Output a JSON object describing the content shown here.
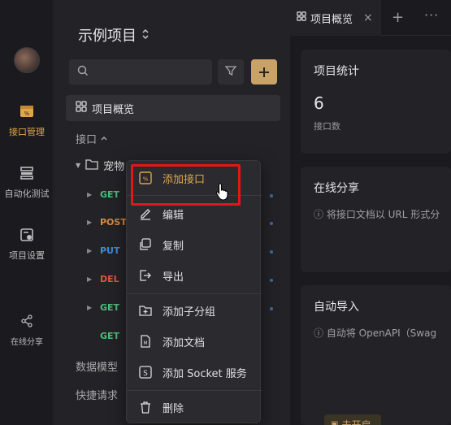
{
  "rail": {
    "items": [
      {
        "label": "接口管理",
        "icon": "api-management-icon"
      },
      {
        "label": "自动化测试",
        "icon": "automation-icon"
      },
      {
        "label": "项目设置",
        "icon": "settings-icon"
      },
      {
        "label": "在线分享",
        "icon": "share-icon"
      }
    ]
  },
  "sidebar": {
    "project_title": "示例项目",
    "search_placeholder": "",
    "overview_label": "项目概览",
    "section_api": "接口",
    "folder_name": "宠物",
    "apis": [
      {
        "method": "GET"
      },
      {
        "method": "POST"
      },
      {
        "method": "PUT"
      },
      {
        "method": "DEL"
      },
      {
        "method": "GET"
      },
      {
        "method": "GET"
      }
    ],
    "section_models": "数据模型",
    "section_quick": "快捷请求"
  },
  "tabs": {
    "active_label": "项目概览",
    "close": "×",
    "plus": "+",
    "more": "···"
  },
  "main": {
    "stats_title": "项目统计",
    "stats_count": "6",
    "stats_count_label": "接口数",
    "share_title": "在线分享",
    "share_info": "ⓘ 将接口文档以 URL 形式分",
    "import_title": "自动导入",
    "import_info": "ⓘ 自动将 OpenAPI（Swag",
    "open_button": "去开启"
  },
  "context_menu": {
    "items": [
      {
        "label": "添加接口",
        "icon": "add-api-icon"
      },
      {
        "label": "编辑",
        "icon": "edit-icon"
      },
      {
        "label": "复制",
        "icon": "copy-icon"
      },
      {
        "label": "导出",
        "icon": "export-icon"
      },
      {
        "label": "添加子分组",
        "icon": "add-subgroup-icon"
      },
      {
        "label": "添加文档",
        "icon": "add-doc-icon"
      },
      {
        "label": "添加 Socket 服务",
        "icon": "add-socket-icon"
      },
      {
        "label": "删除",
        "icon": "delete-icon"
      }
    ]
  },
  "colors": {
    "accent": "#c9a268",
    "get": "#4bbd7a",
    "post": "#e08a3c",
    "put": "#3d8be0",
    "del": "#e0553d",
    "highlight": "#e01818"
  }
}
